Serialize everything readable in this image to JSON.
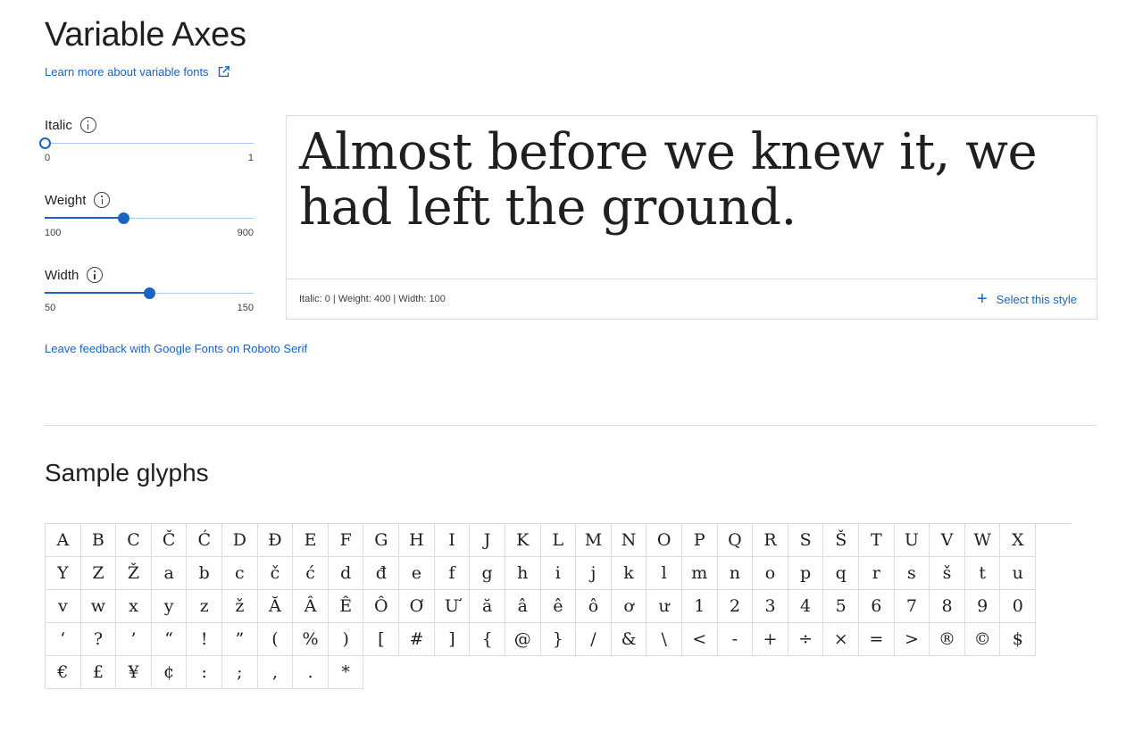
{
  "header": {
    "title": "Variable Axes",
    "learn_more": "Learn more about variable fonts"
  },
  "axes": [
    {
      "label": "Italic",
      "min": "0",
      "max": "1",
      "value": 0,
      "min_num": 0,
      "max_num": 1
    },
    {
      "label": "Weight",
      "min": "100",
      "max": "900",
      "value": 400,
      "min_num": 100,
      "max_num": 900
    },
    {
      "label": "Width",
      "min": "50",
      "max": "150",
      "value": 100,
      "min_num": 50,
      "max_num": 150
    }
  ],
  "preview": {
    "text": "Almost before we knew it, we had left the ground.",
    "meta": "Italic: 0 | Weight: 400 | Width: 100",
    "select_label": "Select this style"
  },
  "feedback_link": "Leave feedback with Google Fonts on Roboto Serif",
  "glyphs": {
    "title": "Sample glyphs",
    "items": [
      "A",
      "B",
      "C",
      "Č",
      "Ć",
      "D",
      "Đ",
      "E",
      "F",
      "G",
      "H",
      "I",
      "J",
      "K",
      "L",
      "M",
      "N",
      "O",
      "P",
      "Q",
      "R",
      "S",
      "Š",
      "T",
      "U",
      "V",
      "W",
      "X",
      "Y",
      "Z",
      "Ž",
      "a",
      "b",
      "c",
      "č",
      "ć",
      "d",
      "đ",
      "e",
      "f",
      "g",
      "h",
      "i",
      "j",
      "k",
      "l",
      "m",
      "n",
      "o",
      "p",
      "q",
      "r",
      "s",
      "š",
      "t",
      "u",
      "v",
      "w",
      "x",
      "y",
      "z",
      "ž",
      "Ă",
      "Â",
      "Ê",
      "Ô",
      "Ơ",
      "Ư",
      "ă",
      "â",
      "ê",
      "ô",
      "ơ",
      "ư",
      "1",
      "2",
      "3",
      "4",
      "5",
      "6",
      "7",
      "8",
      "9",
      "0",
      "‘",
      "?",
      "’",
      "“",
      "!",
      "”",
      "(",
      "%",
      ")",
      "[",
      "#",
      "]",
      "{",
      "@",
      "}",
      "/",
      "&",
      "\\",
      "<",
      "-",
      "+",
      "÷",
      "×",
      "=",
      ">",
      "®",
      "©",
      "$",
      "€",
      "£",
      "¥",
      "¢",
      ":",
      ";",
      ",",
      ".",
      "*"
    ]
  },
  "colors": {
    "accent": "#1a63c2",
    "track": "#a8c7fa",
    "border": "#dadce0"
  }
}
